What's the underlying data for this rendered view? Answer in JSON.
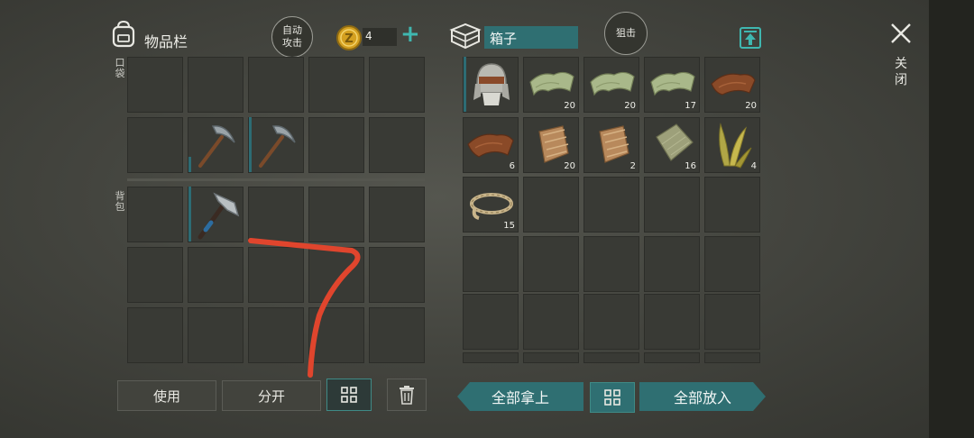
{
  "inventory": {
    "title": "物品栏",
    "auto_attack": [
      "自动",
      "攻击"
    ],
    "coins": "4",
    "plus": "+",
    "pocket_label": [
      "口",
      "袋"
    ],
    "backpack_label": [
      "背",
      "包"
    ]
  },
  "container": {
    "name": "箱子",
    "snipe_button": "狙击"
  },
  "close": {
    "label": [
      "关",
      "闭"
    ]
  },
  "buttons": {
    "use": "使用",
    "split": "分开",
    "take_all": "全部拿上",
    "put_all": "全部放入"
  },
  "chest_items": [
    {
      "name": "fur-hat",
      "qty": ""
    },
    {
      "name": "cloth",
      "qty": "20"
    },
    {
      "name": "cloth",
      "qty": "20"
    },
    {
      "name": "cloth",
      "qty": "17"
    },
    {
      "name": "leather",
      "qty": "20"
    },
    {
      "name": "leather",
      "qty": "6"
    },
    {
      "name": "fur",
      "qty": "20"
    },
    {
      "name": "fur",
      "qty": "2"
    },
    {
      "name": "burlap",
      "qty": "16"
    },
    {
      "name": "plant-fiber",
      "qty": "4"
    },
    {
      "name": "rope",
      "qty": "15"
    }
  ],
  "inventory_items": [
    {
      "name": "pickaxe",
      "slot": "pocket-row2-col2"
    },
    {
      "name": "pickaxe",
      "slot": "pocket-row2-col3"
    },
    {
      "name": "hatchet",
      "slot": "backpack-row1-col2"
    }
  ],
  "colors": {
    "accent_teal": "#2f6f72",
    "annotation_red": "#e0452d",
    "coin_gold": "#d4a020"
  }
}
